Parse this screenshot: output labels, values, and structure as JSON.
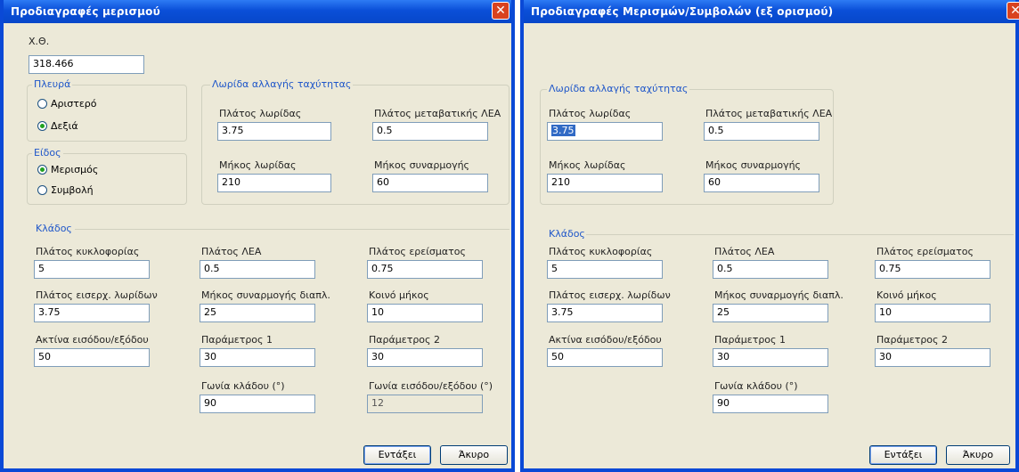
{
  "dialog1": {
    "title": "Προδιαγραφές μερισμού",
    "close_glyph": "✕",
    "chainage_label": "Χ.Θ.",
    "chainage_value": "318.466",
    "side_group": "Πλευρά",
    "side_left": "Αριστερό",
    "side_right": "Δεξιά",
    "type_group": "Είδος",
    "type_split": "Μερισμός",
    "type_merge": "Συμβολή",
    "speed_group": "Λωρίδα αλλαγής ταχύτητας",
    "lane_width_label": "Πλάτος λωρίδας",
    "lane_width_value": "3.75",
    "transition_width_label": "Πλάτος μεταβατικής ΛΕΑ",
    "transition_width_value": "0.5",
    "lane_length_label": "Μήκος λωρίδας",
    "lane_length_value": "210",
    "taper_length_label": "Μήκος συναρμογής",
    "taper_length_value": "60",
    "branch_group": "Κλάδος",
    "traffic_width_label": "Πλάτος κυκλοφορίας",
    "traffic_width_value": "5",
    "shoulder_width_label": "Πλάτος ΛΕΑ",
    "shoulder_width_value": "0.5",
    "support_width_label": "Πλάτος ερείσματος",
    "support_width_value": "0.75",
    "entry_width_label": "Πλάτος εισερχ. λωρίδων",
    "entry_width_value": "3.75",
    "branch_taper_label": "Μήκος συναρμογής διαπλ.",
    "branch_taper_value": "25",
    "common_length_label": "Κοινό μήκος",
    "common_length_value": "10",
    "radius_label": "Ακτίνα εισόδου/εξόδου",
    "radius_value": "50",
    "param1_label": "Παράμετρος 1",
    "param1_value": "30",
    "param2_label": "Παράμετρος 2",
    "param2_value": "30",
    "branch_angle_label": "Γωνία κλάδου (°)",
    "branch_angle_value": "90",
    "entry_angle_label": "Γωνία εισόδου/εξόδου (°)",
    "entry_angle_value": "12",
    "ok": "Εντάξει",
    "cancel": "Άκυρο"
  },
  "dialog2": {
    "title": "Προδιαγραφές Μερισμών/Συμβολών (εξ ορισμού)",
    "close_glyph": "✕",
    "speed_group": "Λωρίδα αλλαγής ταχύτητας",
    "lane_width_label": "Πλάτος λωρίδας",
    "lane_width_value": "3.75",
    "transition_width_label": "Πλάτος μεταβατικής ΛΕΑ",
    "transition_width_value": "0.5",
    "lane_length_label": "Μήκος λωρίδας",
    "lane_length_value": "210",
    "taper_length_label": "Μήκος συναρμογής",
    "taper_length_value": "60",
    "branch_group": "Κλάδος",
    "traffic_width_label": "Πλάτος κυκλοφορίας",
    "traffic_width_value": "5",
    "shoulder_width_label": "Πλάτος ΛΕΑ",
    "shoulder_width_value": "0.5",
    "support_width_label": "Πλάτος ερείσματος",
    "support_width_value": "0.75",
    "entry_width_label": "Πλάτος εισερχ. λωρίδων",
    "entry_width_value": "3.75",
    "branch_taper_label": "Μήκος συναρμογής διαπλ.",
    "branch_taper_value": "25",
    "common_length_label": "Κοινό μήκος",
    "common_length_value": "10",
    "radius_label": "Ακτίνα εισόδου/εξόδου",
    "radius_value": "50",
    "param1_label": "Παράμετρος 1",
    "param1_value": "30",
    "param2_label": "Παράμετρος 2",
    "param2_value": "30",
    "branch_angle_label": "Γωνία κλάδου (°)",
    "branch_angle_value": "90",
    "ok": "Εντάξει",
    "cancel": "Άκυρο"
  }
}
